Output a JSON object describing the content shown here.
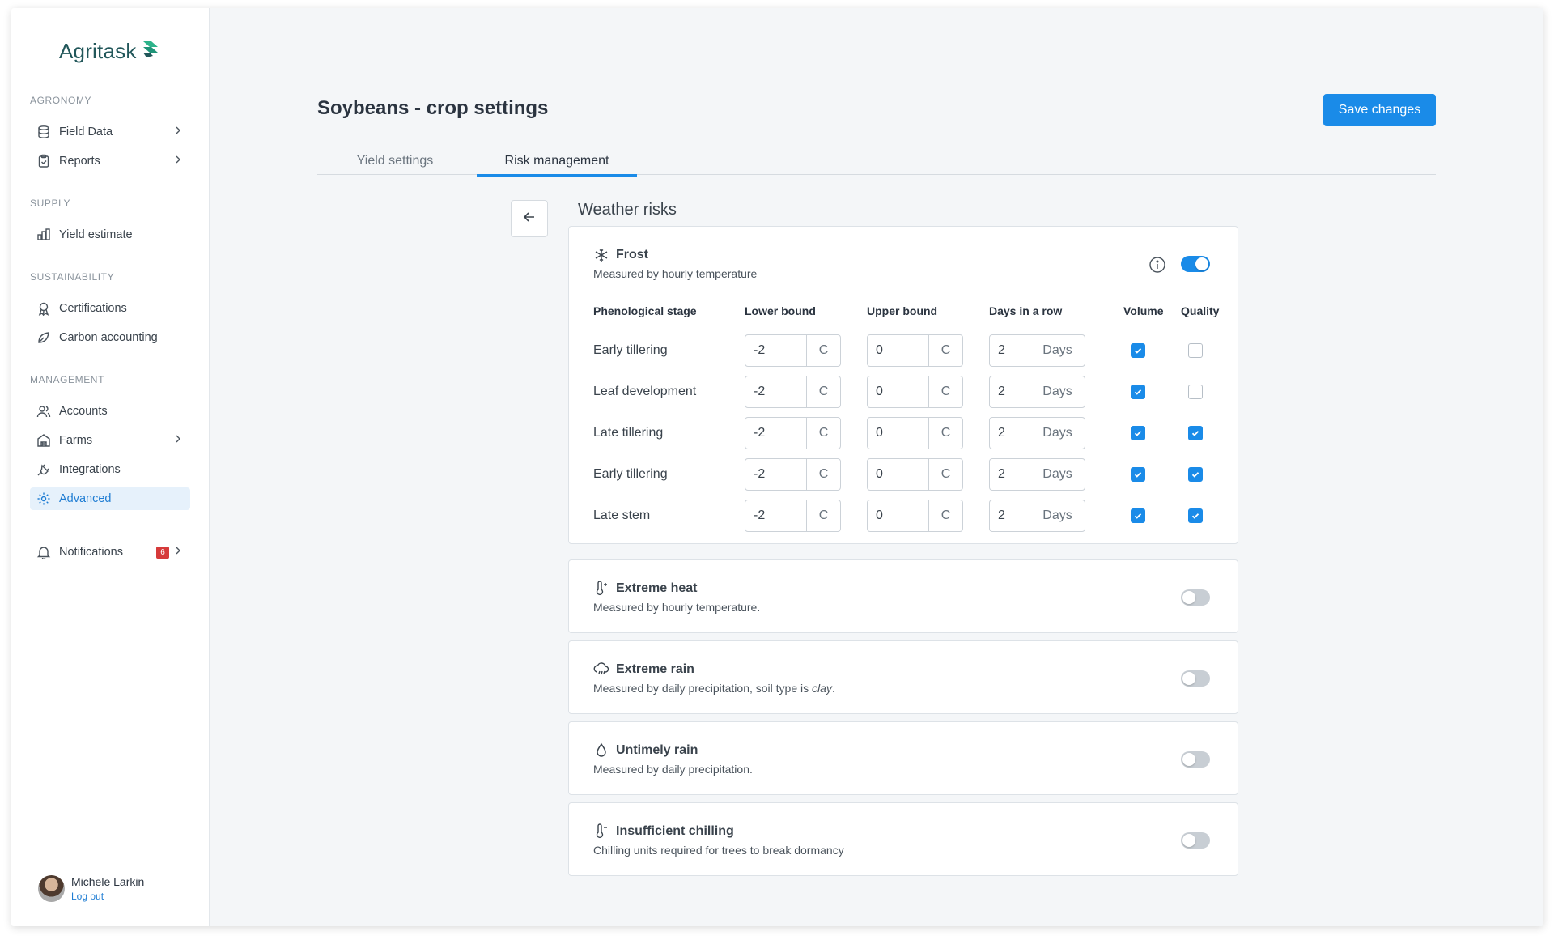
{
  "app": {
    "logo_text": "Agritask"
  },
  "sidebar": {
    "sections": [
      {
        "label": "AGRONOMY"
      },
      {
        "label": "SUPPLY"
      },
      {
        "label": "SUSTAINABILITY"
      },
      {
        "label": "MANAGEMENT"
      }
    ],
    "items": [
      {
        "label": "Field Data",
        "icon": "database-icon",
        "has_chevron": true
      },
      {
        "label": "Reports",
        "icon": "clipboard-icon",
        "has_chevron": true
      },
      {
        "label": "Yield estimate",
        "icon": "bar-chart-icon",
        "has_chevron": false
      },
      {
        "label": "Certifications",
        "icon": "award-icon",
        "has_chevron": false
      },
      {
        "label": "Carbon accounting",
        "icon": "leaf-icon",
        "has_chevron": false
      },
      {
        "label": "Accounts",
        "icon": "users-icon",
        "has_chevron": false
      },
      {
        "label": "Farms",
        "icon": "barn-icon",
        "has_chevron": true
      },
      {
        "label": "Integrations",
        "icon": "plug-icon",
        "has_chevron": false
      },
      {
        "label": "Advanced",
        "icon": "gear-icon",
        "has_chevron": false,
        "active": true
      },
      {
        "label": "Notifications",
        "icon": "bell-icon",
        "has_chevron": true,
        "badge": "6"
      }
    ],
    "user": {
      "name": "Michele Larkin",
      "logout_label": "Log out"
    }
  },
  "header": {
    "title": "Soybeans - crop settings",
    "save_label": "Save changes"
  },
  "tabs": [
    {
      "label": "Yield settings",
      "active": false
    },
    {
      "label": "Risk management",
      "active": true
    }
  ],
  "weather": {
    "section_title": "Weather risks",
    "frost": {
      "title": "Frost",
      "subtitle": "Measured by hourly temperature",
      "enabled": true,
      "columns": {
        "stage": "Phenological stage",
        "lower": "Lower bound",
        "upper": "Upper bound",
        "days": "Days in a row",
        "volume": "Volume",
        "quality": "Quality"
      },
      "unit_temp": "C",
      "unit_days": "Days",
      "rows": [
        {
          "stage": "Early tillering",
          "lower": "-2",
          "upper": "0",
          "days": "2",
          "volume": true,
          "quality": false
        },
        {
          "stage": "Leaf development",
          "lower": "-2",
          "upper": "0",
          "days": "2",
          "volume": true,
          "quality": false
        },
        {
          "stage": "Late tillering",
          "lower": "-2",
          "upper": "0",
          "days": "2",
          "volume": true,
          "quality": true
        },
        {
          "stage": "Early tillering",
          "lower": "-2",
          "upper": "0",
          "days": "2",
          "volume": true,
          "quality": true
        },
        {
          "stage": "Late stem",
          "lower": "-2",
          "upper": "0",
          "days": "2",
          "volume": true,
          "quality": true
        }
      ]
    },
    "risks": [
      {
        "title": "Extreme heat",
        "subtitle": "Measured by hourly temperature.",
        "icon": "thermometer-plus-icon",
        "enabled": false
      },
      {
        "title": "Extreme rain",
        "subtitle_pre": "Measured by daily precipitation, soil type is ",
        "subtitle_em": "clay",
        "subtitle_post": ".",
        "icon": "cloud-rain-icon",
        "enabled": false
      },
      {
        "title": "Untimely rain",
        "subtitle": "Measured by daily precipitation.",
        "icon": "droplet-icon",
        "enabled": false
      },
      {
        "title": "Insufficient chilling",
        "subtitle": "Chilling units required for trees to break dormancy",
        "icon": "thermometer-minus-icon",
        "enabled": false
      }
    ]
  },
  "colors": {
    "accent": "#1a8be8",
    "brand": "#22575a",
    "badge": "#d63a3a"
  }
}
